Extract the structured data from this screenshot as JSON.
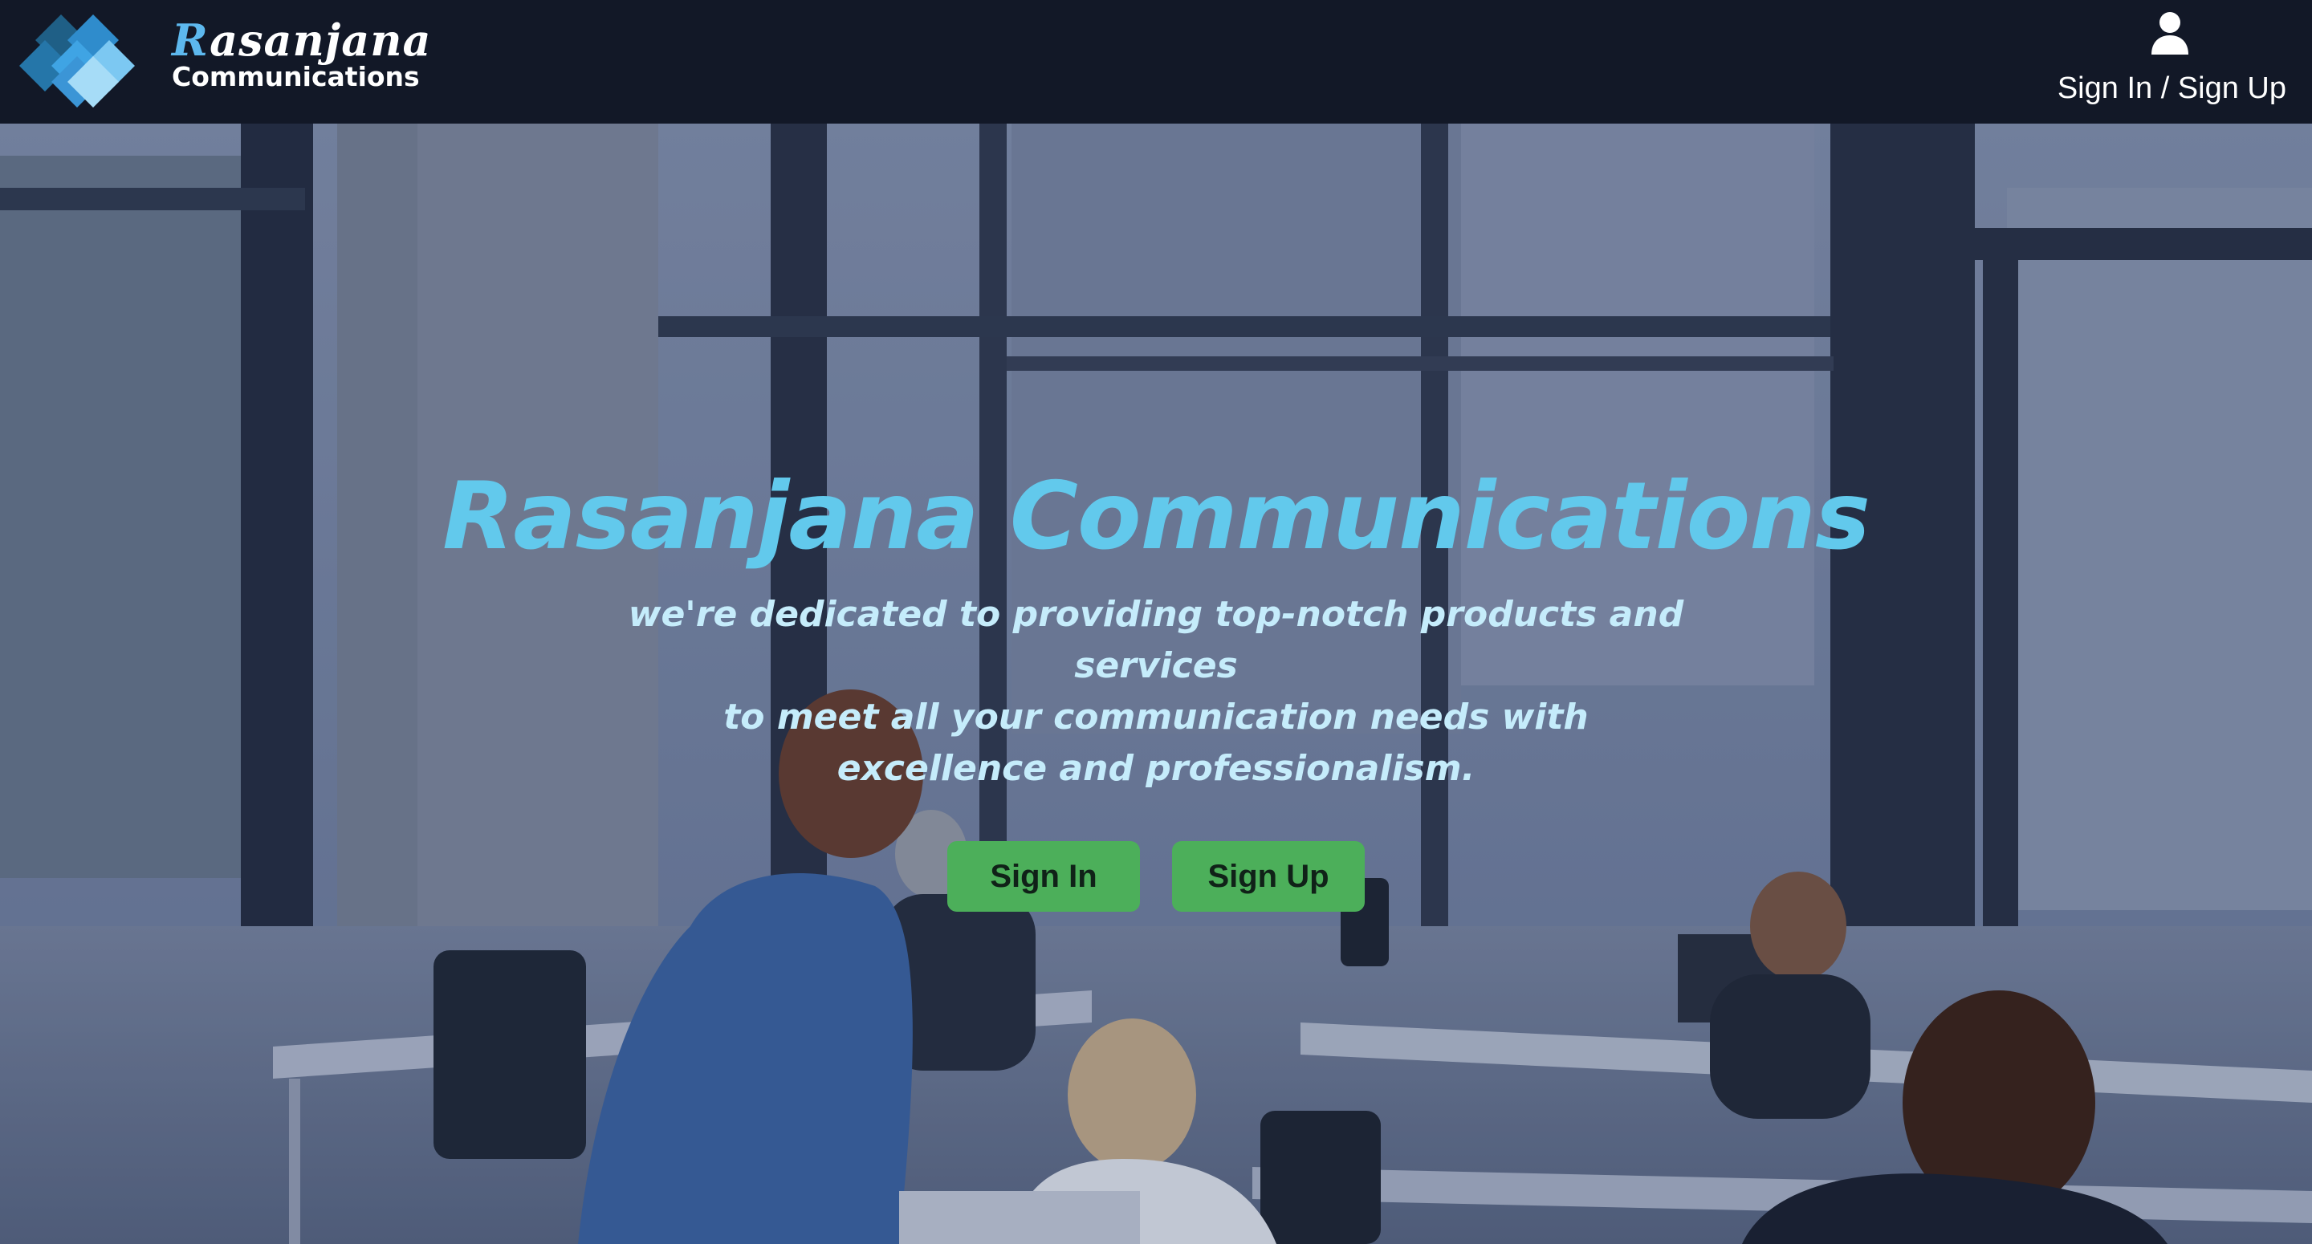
{
  "header": {
    "brand_initial": "R",
    "brand_rest": "asanjana",
    "brand_subtitle": "Communications",
    "account_label": "Sign In / Sign Up",
    "logo_icon": "diamond-grid-logo",
    "user_icon": "user-icon"
  },
  "hero": {
    "title": "Rasanjana Communications",
    "tagline_lines": [
      "we're dedicated to providing top-notch products and services",
      "to meet all your communication needs with",
      "excellence and professionalism."
    ],
    "sign_in_label": "Sign In",
    "sign_up_label": "Sign Up"
  },
  "colors": {
    "header_bg": "#121827",
    "brand_accent": "#5db8ee",
    "title": "#62c9ec",
    "tagline": "#c5ecfb",
    "button_bg": "#4caf5a",
    "button_text": "#102218"
  }
}
